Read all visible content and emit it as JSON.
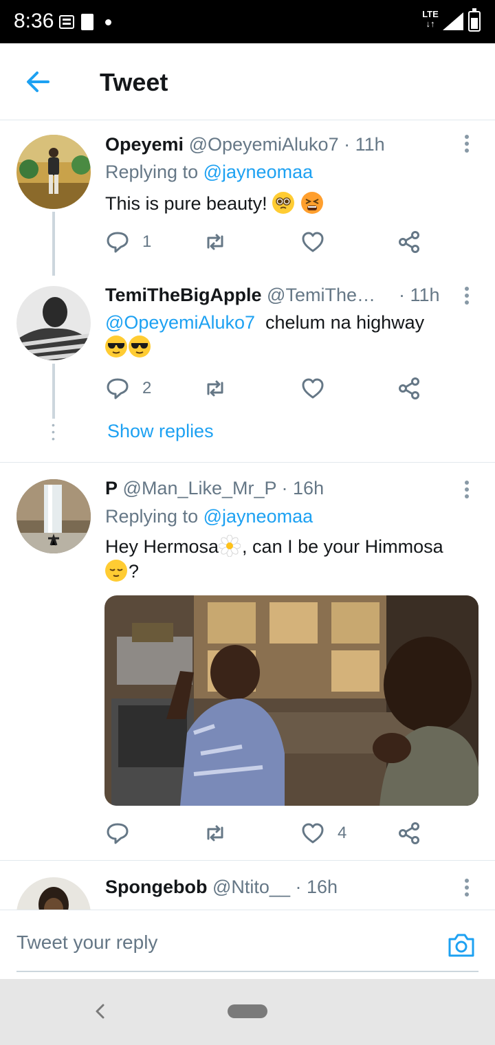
{
  "status_bar": {
    "time": "8:36",
    "network": "LTE"
  },
  "header": {
    "title": "Tweet"
  },
  "tweets": [
    {
      "name": "Opeyemi",
      "handle": "@OpeyemiAluko7 · 11h",
      "replying_prefix": "Replying to",
      "replying_to": "@jayneomaa",
      "text": "This is pure beauty!",
      "emojis": [
        "pleading-face",
        "tired-face"
      ],
      "reply_count": "1"
    },
    {
      "name": "TemiTheBigApple",
      "handle": "@TemiThe…",
      "time": "· 11h",
      "mention": "@OpeyemiAluko7",
      "text": "chelum na highway",
      "emojis": [
        "sunglasses-face",
        "sunglasses-face"
      ],
      "reply_count": "2",
      "show_replies": "Show replies"
    },
    {
      "name": "P",
      "handle": "@Man_Like_Mr_P · 16h",
      "replying_prefix": "Replying to",
      "replying_to": "@jayneomaa",
      "text_part1": "Hey Hermosa",
      "text_part2": ", can I be your Himmosa",
      "text_part3": "?",
      "emojis": [
        "blossom",
        "relieved-face"
      ],
      "like_count": "4"
    },
    {
      "name": "Spongebob",
      "handle": "@Ntito__ · 16h"
    }
  ],
  "reply_bar": {
    "placeholder": "Tweet your reply"
  },
  "colors": {
    "accent": "#1da1f2",
    "secondary_text": "#657786",
    "divider": "#e1e8ed"
  }
}
